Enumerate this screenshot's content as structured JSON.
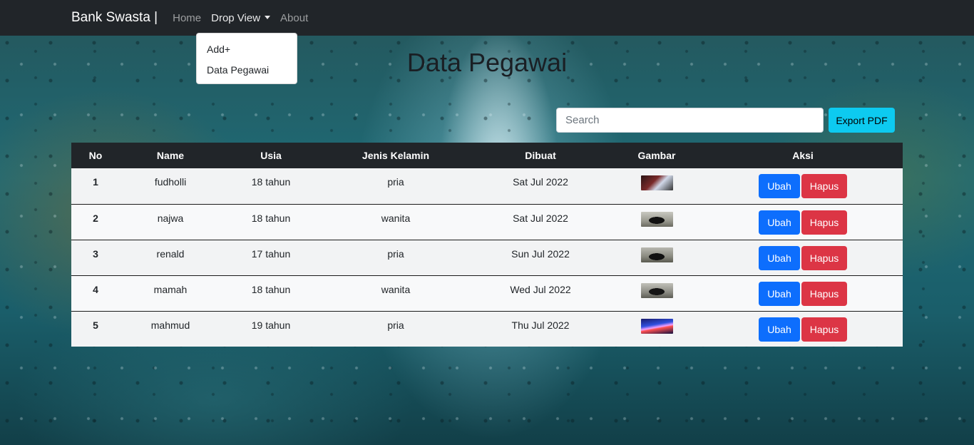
{
  "navbar": {
    "brand": "Bank Swasta |",
    "links": [
      {
        "label": "Home"
      },
      {
        "label": "Drop View"
      },
      {
        "label": "About"
      }
    ],
    "dropdown": [
      "Add+",
      "Data Pegawai"
    ]
  },
  "page": {
    "title": "Data Pegawai",
    "search_placeholder": "Search",
    "export_label": "Export PDF"
  },
  "table": {
    "headers": [
      "No",
      "Name",
      "Usia",
      "Jenis Kelamin",
      "Dibuat",
      "Gambar",
      "Aksi"
    ],
    "rows": [
      {
        "no": "1",
        "name": "fudholli",
        "usia": "18 tahun",
        "jk": "pria",
        "dibuat": "Sat Jul 2022"
      },
      {
        "no": "2",
        "name": "najwa",
        "usia": "18 tahun",
        "jk": "wanita",
        "dibuat": "Sat Jul 2022"
      },
      {
        "no": "3",
        "name": "renald",
        "usia": "17 tahun",
        "jk": "pria",
        "dibuat": "Sun Jul 2022"
      },
      {
        "no": "4",
        "name": "mamah",
        "usia": "18 tahun",
        "jk": "wanita",
        "dibuat": "Wed Jul 2022"
      },
      {
        "no": "5",
        "name": "mahmud",
        "usia": "19 tahun",
        "jk": "pria",
        "dibuat": "Thu Jul 2022"
      }
    ],
    "ubah_label": "Ubah",
    "hapus_label": "Hapus"
  },
  "colors": {
    "navbar": "#212529",
    "primary": "#0d6efd",
    "danger": "#dc3545",
    "info": "#0dcaf0"
  }
}
